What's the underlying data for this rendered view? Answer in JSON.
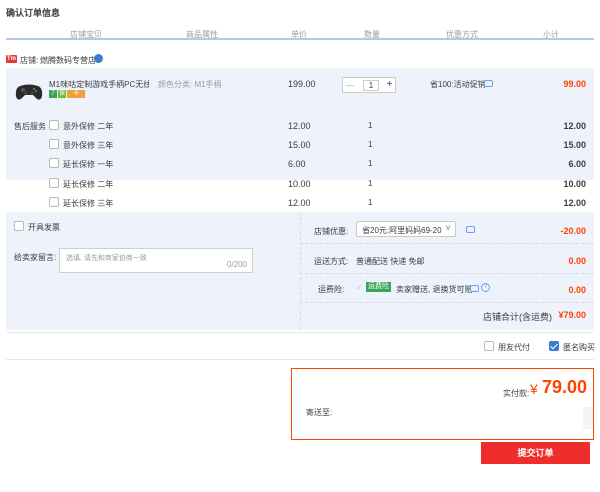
{
  "page": {
    "title": "确认订单信息"
  },
  "columns": [
    "店铺宝贝",
    "商品属性",
    "单价",
    "数量",
    "优惠方式",
    "小计"
  ],
  "shop": {
    "badge": "Tm",
    "label": "店铺:",
    "name": "燃腾数码专营店"
  },
  "product": {
    "title": "M1咪咕定制游戏手柄PC无线2...",
    "attr": "颜色分类: M1手柄",
    "price": "199.00",
    "quantity": "1",
    "promo": "省100:活动促销",
    "subtotal": "99.00",
    "badges": [
      {
        "text": "7",
        "color": "#3aa55a"
      },
      {
        "text": "保",
        "color": "#6fbb3a"
      },
      {
        "text": "卡",
        "color": "#f0a23a"
      }
    ]
  },
  "aftersale": {
    "label": "售后服务",
    "items": [
      {
        "name": "意外保修 二年",
        "price": "12.00",
        "qty": "1",
        "subtotal": "12.00"
      },
      {
        "name": "意外保修 三年",
        "price": "15.00",
        "qty": "1",
        "subtotal": "15.00"
      },
      {
        "name": "延长保修 一年",
        "price": "6.00",
        "qty": "1",
        "subtotal": "6.00"
      },
      {
        "name": "延长保修 二年",
        "price": "10.00",
        "qty": "1",
        "subtotal": "10.00"
      },
      {
        "name": "延长保修 三年",
        "price": "12.00",
        "qty": "1",
        "subtotal": "12.00"
      }
    ]
  },
  "invoice": {
    "label": "开具发票"
  },
  "shop_discount": {
    "label": "店铺优惠:",
    "value": "省20元:阿里妈妈69-20",
    "amount": "-20.00"
  },
  "message": {
    "label": "给卖家留言:",
    "placeholder": "选填, 请先和商家协商一致",
    "counter": "0/200"
  },
  "shipping": {
    "label": "运送方式:",
    "value": "普通配送 快递 免邮",
    "amount": "0.00"
  },
  "insurance": {
    "label": "运费险:",
    "tag": "运费险",
    "text": "卖家赠送, 退换货可赔",
    "amount": "0.00"
  },
  "shop_total": {
    "label": "店铺合计(含运费)",
    "amount": "¥79.00"
  },
  "options": {
    "friend_pay": "朋友代付",
    "anonymous": "匿名购买"
  },
  "summary": {
    "paid_label": "实付款:",
    "currency": "¥",
    "paid_amount": "79.00",
    "ship_to_label": "寄送至:"
  },
  "submit": {
    "label": "提交订单"
  }
}
